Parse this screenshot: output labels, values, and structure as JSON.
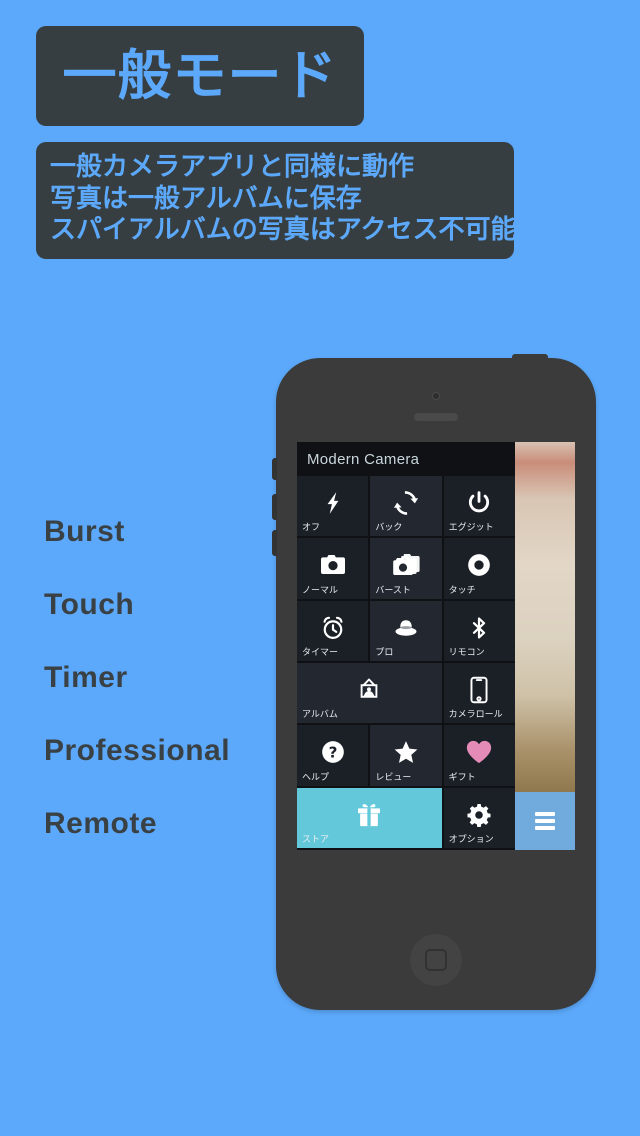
{
  "colors": {
    "background": "#5CA9FB",
    "panel_dark": "#373E41",
    "title_text": "#5CA9FB",
    "feature_text": "#3A4145",
    "phone_body": "#3B3B3B",
    "app_bg": "#0F1115",
    "tile_bg": "#1B2027",
    "tile_bg_alt": "#222730",
    "store_tile": "#63C8DA",
    "menu_button": "#71AADD",
    "gift_heart": "#E58BB8"
  },
  "banner": {
    "title": "一般モード"
  },
  "description": {
    "lines": [
      "一般カメラアプリと同様に動作",
      "写真は一般アルバムに保存",
      "スパイアルバムの写真はアクセス不可能"
    ]
  },
  "features": {
    "items": [
      {
        "label": "Burst"
      },
      {
        "label": "Touch"
      },
      {
        "label": "Timer"
      },
      {
        "label": "Professional"
      },
      {
        "label": "Remote"
      }
    ]
  },
  "phone": {
    "app": {
      "title": "Modern Camera",
      "tiles": [
        {
          "label": "オフ",
          "icon": "flash-icon",
          "style": "normal"
        },
        {
          "label": "バック",
          "icon": "camera-flip-icon",
          "style": "alt"
        },
        {
          "label": "エグジット",
          "icon": "power-icon",
          "style": "normal"
        },
        {
          "label": "ノーマル",
          "icon": "camera-icon",
          "style": "normal"
        },
        {
          "label": "バースト",
          "icon": "burst-icon",
          "style": "alt"
        },
        {
          "label": "タッチ",
          "icon": "touch-ring-icon",
          "style": "normal"
        },
        {
          "label": "タイマー",
          "icon": "alarm-clock-icon",
          "style": "normal"
        },
        {
          "label": "プロ",
          "icon": "hat-icon",
          "style": "alt"
        },
        {
          "label": "リモコン",
          "icon": "bluetooth-icon",
          "style": "normal"
        },
        {
          "label": "アルバム",
          "icon": "picture-frame-icon",
          "style": "alt",
          "span": 2
        },
        {
          "label": "カメラロール",
          "icon": "phone-icon",
          "style": "normal"
        },
        {
          "label": "ヘルプ",
          "icon": "question-icon",
          "style": "normal"
        },
        {
          "label": "レビュー",
          "icon": "star-icon",
          "style": "alt"
        },
        {
          "label": "ギフト",
          "icon": "heart-icon",
          "style": "normal"
        },
        {
          "label": "ストア",
          "icon": "gift-icon",
          "style": "store",
          "span": 2
        },
        {
          "label": "オプション",
          "icon": "gear-icon",
          "style": "normal"
        }
      ],
      "menu_button": "menu-hamburger-icon"
    }
  }
}
